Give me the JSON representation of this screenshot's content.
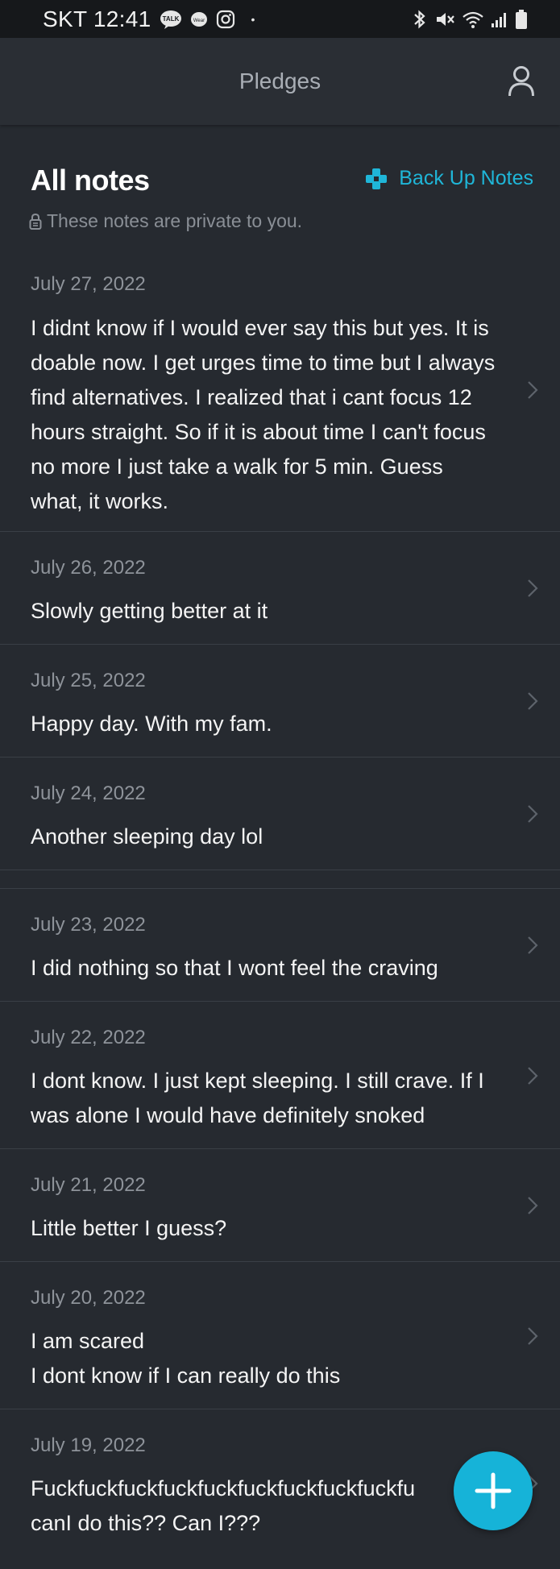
{
  "status_bar": {
    "carrier_time": "SKT 12:41",
    "talk_icon_label": "TALK",
    "wear_icon_label": "Wear",
    "dot": "•"
  },
  "app_bar": {
    "title": "Pledges"
  },
  "header": {
    "title": "All notes",
    "backup_label": "Back Up Notes",
    "private_note": "These notes are private to you."
  },
  "notes": [
    {
      "date": "July 27, 2022",
      "text": "I didnt know if I would ever say this but yes. It is doable now. I get urges time to time but I always find alternatives. I realized that i cant focus 12 hours straight. So if it is about time I can't focus no more I just take a walk for 5 min. Guess what, it works."
    },
    {
      "date": "July 26, 2022",
      "text": "Slowly getting better at it"
    },
    {
      "date": "July 25, 2022",
      "text": "Happy day. With my fam."
    },
    {
      "date": "July 24, 2022",
      "text": "Another sleeping day lol"
    },
    {
      "date": "July 23, 2022",
      "text": "I did nothing so that I wont feel the craving"
    },
    {
      "date": "July 22, 2022",
      "text": "I dont know. I just kept sleeping. I still crave. If I was alone I would have definitely snoked"
    },
    {
      "date": "July 21, 2022",
      "text": "Little better I guess?"
    },
    {
      "date": "July 20, 2022",
      "text": "I am scared\nI dont know if I can really do this"
    },
    {
      "date": "July 19, 2022",
      "text": "Fuckfuckfuckfuckfuckfuckfuckfuckfuckfu\ncanI do this?? Can I???"
    }
  ],
  "colors": {
    "accent": "#16b3d8",
    "background": "#262a30",
    "app_bar": "#2a2e34",
    "status_bar": "#16181b"
  },
  "icons": {
    "profile": "person-outline-icon",
    "backup": "backup-cross-icon",
    "lock": "lock-icon",
    "chevron": "chevron-right-icon",
    "fab": "plus-icon"
  }
}
